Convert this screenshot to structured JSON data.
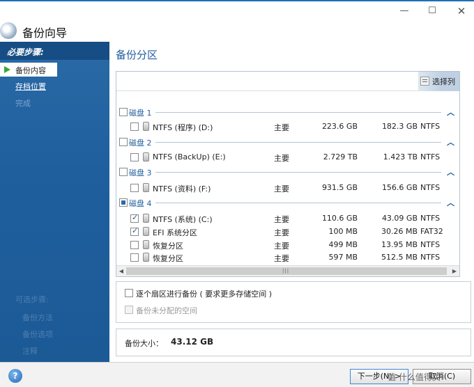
{
  "window": {
    "title": "备份向导"
  },
  "sidebar": {
    "required_heading": "必要步骤:",
    "items": [
      {
        "label": "备份内容",
        "state": "active"
      },
      {
        "label": "存档位置",
        "state": "link"
      },
      {
        "label": "完成",
        "state": "disabled"
      }
    ],
    "optional_heading": "可选步骤:",
    "optional_items": [
      "备份方法",
      "备份选项",
      "注释"
    ]
  },
  "main": {
    "section_title": "备份分区",
    "select_columns_label": "选择列",
    "disks": [
      {
        "label": "磁盘 1",
        "partitions": [
          {
            "name": "NTFS (程序) (D:)",
            "type": "主要",
            "total": "223.6 GB",
            "free": "182.3 GB",
            "fs": "NTFS",
            "checked": false
          }
        ]
      },
      {
        "label": "磁盘 2",
        "partitions": [
          {
            "name": "NTFS (BackUp) (E:)",
            "type": "主要",
            "total": "2.729 TB",
            "free": "1.423 TB",
            "fs": "NTFS",
            "checked": false
          }
        ]
      },
      {
        "label": "磁盘 3",
        "partitions": [
          {
            "name": "NTFS (资料) (F:)",
            "type": "主要",
            "total": "931.5 GB",
            "free": "156.6 GB",
            "fs": "NTFS",
            "checked": false
          }
        ]
      },
      {
        "label": "磁盘 4",
        "partitions": [
          {
            "name": "NTFS (系统) (C:)",
            "type": "主要",
            "total": "110.6 GB",
            "free": "43.09 GB",
            "fs": "NTFS",
            "checked": true
          },
          {
            "name": "EFI 系统分区",
            "type": "主要",
            "total": "100 MB",
            "free": "30.26 MB",
            "fs": "FAT32",
            "checked": true
          },
          {
            "name": "恢复分区",
            "type": "主要",
            "total": "499 MB",
            "free": "13.95 MB",
            "fs": "NTFS",
            "checked": false
          },
          {
            "name": "恢复分区",
            "type": "主要",
            "total": "597 MB",
            "free": "512.5 MB",
            "fs": "NTFS",
            "checked": false
          }
        ]
      }
    ],
    "options": {
      "sector_by_sector": "逐个扇区进行备份 ( 要求更多存储空间 )",
      "backup_unallocated": "备份未分配的空间"
    },
    "backup_size_label": "备份大小：",
    "backup_size_value": "43.12 GB"
  },
  "footer": {
    "help_label": "?",
    "next_button": "下一步(N) >",
    "cancel_button": "取消(C)",
    "watermark": "值 什么值得买"
  }
}
